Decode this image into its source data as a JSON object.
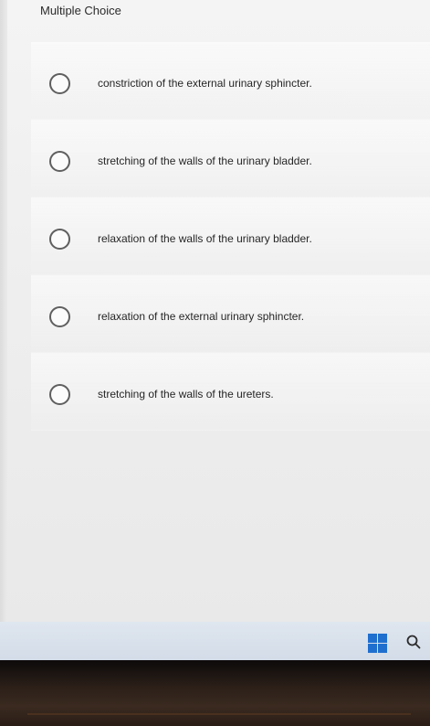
{
  "question": {
    "type_label": "Multiple Choice",
    "options": [
      {
        "label": "constriction of the external urinary sphincter."
      },
      {
        "label": "stretching of the walls of the urinary bladder."
      },
      {
        "label": "relaxation of the walls of the urinary bladder."
      },
      {
        "label": "relaxation of the external urinary sphincter."
      },
      {
        "label": "stretching of the walls of the ureters."
      }
    ]
  },
  "taskbar": {
    "start_icon": "windows-logo-icon",
    "search_icon": "search-icon",
    "accent_color": "#1f6fcf"
  }
}
